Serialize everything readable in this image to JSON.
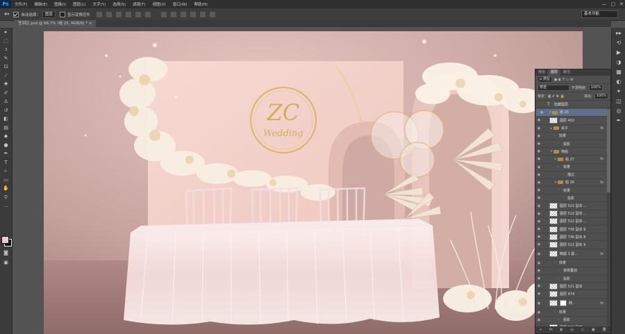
{
  "app": {
    "logo": "Ps",
    "menu": [
      "文件(F)",
      "编辑(E)",
      "图像(I)",
      "图层(L)",
      "文字(Y)",
      "选择(S)",
      "滤镜(T)",
      "视图(V)",
      "窗口(W)",
      "帮助(H)"
    ],
    "window_controls": [
      "—",
      "□",
      "✕"
    ]
  },
  "options_bar": {
    "auto_select_label": "自动选择：",
    "auto_select_value": "图层",
    "transform_controls_label": "显示变换控件",
    "workspace": "基本功能"
  },
  "document": {
    "tab_title": "签到区.psd @ 66.7% (组 25, RGB/8) *"
  },
  "layers_panel": {
    "tabs": [
      "通道",
      "图层",
      "路径"
    ],
    "active_tab": "图层",
    "filter_kind": "ρ 类型",
    "blend_mode": "穿透",
    "opacity_label": "不透明度:",
    "opacity_value": "100%",
    "lock_label": "锁定:",
    "fill_label": "填充:",
    "fill_value": "100%",
    "layers": [
      {
        "name": "隐藏图层",
        "kind": "text",
        "indent": 0,
        "eye": false
      },
      {
        "name": "组 25",
        "kind": "group",
        "indent": 0,
        "eye": true,
        "open": true,
        "selected": true
      },
      {
        "name": "图层 482",
        "kind": "layer",
        "indent": 1,
        "eye": true
      },
      {
        "name": "桌子",
        "kind": "group",
        "indent": 1,
        "eye": true,
        "fx": "fx"
      },
      {
        "name": "效果",
        "kind": "effect",
        "indent": 2,
        "eye": true
      },
      {
        "name": "投影",
        "kind": "effect",
        "indent": 3,
        "eye": true
      },
      {
        "name": "椅组",
        "kind": "group",
        "indent": 1,
        "eye": true,
        "open": true
      },
      {
        "name": "组 27",
        "kind": "group",
        "indent": 2,
        "eye": true,
        "fx": "fx"
      },
      {
        "name": "效果",
        "kind": "effect",
        "indent": 3,
        "eye": true
      },
      {
        "name": "描边",
        "kind": "effect",
        "indent": 4,
        "eye": true
      },
      {
        "name": "组 26",
        "kind": "group",
        "indent": 2,
        "eye": true,
        "open": true,
        "fx": "fx"
      },
      {
        "name": "效果",
        "kind": "effect",
        "indent": 3,
        "eye": true
      },
      {
        "name": "投影",
        "kind": "effect",
        "indent": 4,
        "eye": true
      },
      {
        "name": "图层 522 副本 ...",
        "kind": "layer",
        "indent": 1,
        "eye": true
      },
      {
        "name": "图层 522 副本 ...",
        "kind": "layer",
        "indent": 1,
        "eye": true
      },
      {
        "name": "图层 522 副本 ...",
        "kind": "layer",
        "indent": 1,
        "eye": true
      },
      {
        "name": "图层 736 副本 9",
        "kind": "layer",
        "indent": 1,
        "eye": true
      },
      {
        "name": "图层 736 副本 8",
        "kind": "layer",
        "indent": 1,
        "eye": true
      },
      {
        "name": "图层 522 副本 9",
        "kind": "layer",
        "indent": 1,
        "eye": true
      },
      {
        "name": "椭圆 3 副...",
        "kind": "layer",
        "indent": 1,
        "eye": true,
        "fx": "fx",
        "tall": true
      },
      {
        "name": "效果",
        "kind": "effect",
        "indent": 2,
        "eye": true
      },
      {
        "name": "渐变叠加",
        "kind": "effect",
        "indent": 3,
        "eye": true
      },
      {
        "name": "投影",
        "kind": "effect",
        "indent": 3,
        "eye": true
      },
      {
        "name": "图层 521 副本",
        "kind": "layer",
        "indent": 1,
        "eye": true
      },
      {
        "name": "图层 474",
        "kind": "layer",
        "indent": 1,
        "eye": true
      },
      {
        "name": "椭...",
        "kind": "masked",
        "indent": 1,
        "eye": true,
        "fx": "fx",
        "tall": true
      },
      {
        "name": "效果",
        "kind": "effect",
        "indent": 2,
        "eye": true
      },
      {
        "name": "投影",
        "kind": "effect",
        "indent": 3,
        "eye": true
      },
      {
        "name": "图层 536 副本",
        "kind": "layer",
        "indent": 1,
        "eye": true
      }
    ],
    "footer_icons": [
      "∞",
      "fx",
      "◐",
      "◎",
      "▭",
      "▣",
      "🗑"
    ]
  },
  "artwork": {
    "monogram": "ZC",
    "script_text": "Wedding",
    "colors": {
      "backdrop": "#f1cfc7",
      "gold": "#d9b56a",
      "wall": "#c8a5a1",
      "floor": "#a67f7c",
      "cloth": "#f7e7e5"
    }
  }
}
